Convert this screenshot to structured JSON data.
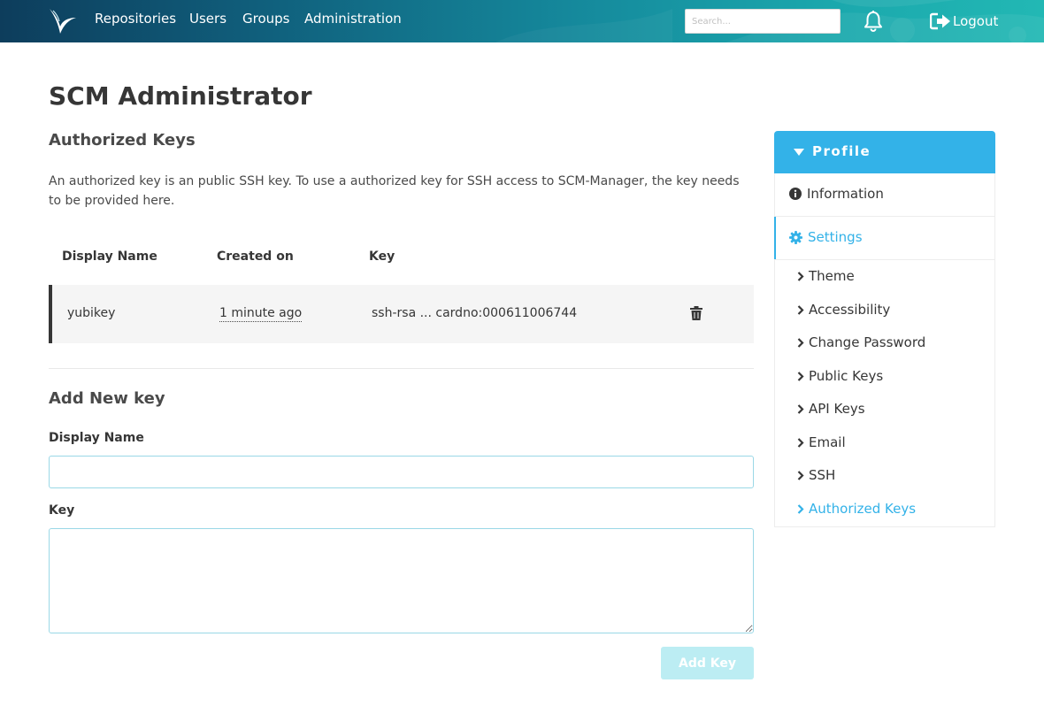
{
  "nav": {
    "items": [
      "Repositories",
      "Users",
      "Groups",
      "Administration"
    ],
    "search_placeholder": "Search...",
    "logout_label": "Logout",
    "logo_icon": "scm-manager-logo-icon",
    "bell_icon": "bell-icon",
    "logout_icon": "sign-out-icon"
  },
  "main": {
    "title": "SCM Administrator",
    "subtitle": "Authorized Keys",
    "description": "An authorized key is an public SSH key. To use a authorized key for SSH access to SCM-Manager, the key needs to be provided here.",
    "table": {
      "headers": [
        "Display Name",
        "Created on",
        "Key"
      ],
      "rows": [
        {
          "display_name": "yubikey",
          "created_on": "1 minute ago",
          "key": "ssh-rsa ... cardno:000611006744",
          "action_icon": "trash-icon"
        }
      ]
    },
    "add_form": {
      "title": "Add New key",
      "display_name_label": "Display Name",
      "display_name_value": "",
      "key_label": "Key",
      "key_value": "",
      "submit_label": "Add Key"
    }
  },
  "sidebar": {
    "header": "Profile",
    "information": "Information",
    "settings": "Settings",
    "sub_items": [
      "Theme",
      "Accessibility",
      "Change Password",
      "Public Keys",
      "API Keys",
      "Email",
      "SSH",
      "Authorized Keys"
    ],
    "active_sub_item": "Authorized Keys"
  },
  "colors": {
    "accent": "#33b2e8",
    "disabled_button": "#bcedf3",
    "input_border": "#9ad8e6",
    "row_background": "#f5f5f5"
  }
}
